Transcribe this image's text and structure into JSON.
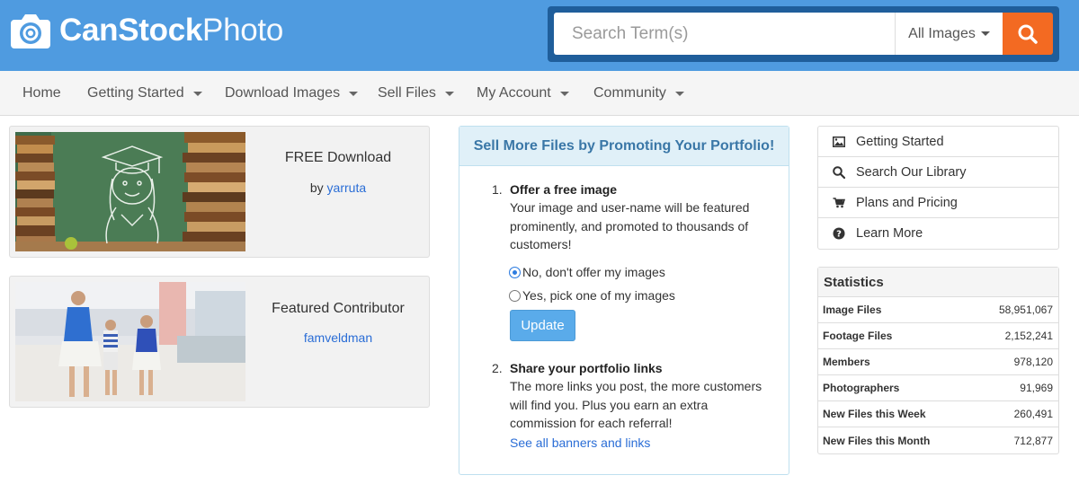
{
  "brand": {
    "name_bold": "CanStock",
    "name_light": "Photo"
  },
  "search": {
    "placeholder": "Search Term(s)",
    "scope": "All Images"
  },
  "nav": {
    "items": [
      {
        "label": "Home",
        "has_dropdown": false
      },
      {
        "label": "Getting Started",
        "has_dropdown": true
      },
      {
        "label": "Download Images",
        "has_dropdown": true
      },
      {
        "label": "Sell Files",
        "has_dropdown": true
      },
      {
        "label": "My Account",
        "has_dropdown": true
      },
      {
        "label": "Community",
        "has_dropdown": true
      }
    ]
  },
  "free_download": {
    "title": "FREE Download",
    "by_prefix": "by",
    "author": "yarruta"
  },
  "featured": {
    "title": "Featured Contributor",
    "author": "famveldman"
  },
  "promo": {
    "heading": "Sell More Files by Promoting Your Portfolio!",
    "step1": {
      "num": "1.",
      "title": "Offer a free image",
      "text": "Your image and user-name will be featured prominently, and promoted to thousands of customers!",
      "option_no": "No, don't offer my images",
      "option_yes": "Yes, pick one of my images",
      "button": "Update"
    },
    "step2": {
      "num": "2.",
      "title": "Share your portfolio links",
      "text": "The more links you post, the more customers will find you. Plus you earn an extra commission for each referral!",
      "link": "See all banners and links"
    }
  },
  "side_menu": {
    "items": [
      {
        "label": "Getting Started",
        "icon": "image-icon"
      },
      {
        "label": "Search Our Library",
        "icon": "search-icon"
      },
      {
        "label": "Plans and Pricing",
        "icon": "cart-icon"
      },
      {
        "label": "Learn More",
        "icon": "question-icon"
      }
    ]
  },
  "stats": {
    "heading": "Statistics",
    "rows": [
      {
        "label": "Image Files",
        "value": "58,951,067"
      },
      {
        "label": "Footage Files",
        "value": "2,152,241"
      },
      {
        "label": "Members",
        "value": "978,120"
      },
      {
        "label": "Photographers",
        "value": "91,969"
      },
      {
        "label": "New Files this Week",
        "value": "260,491"
      },
      {
        "label": "New Files this Month",
        "value": "712,877"
      }
    ]
  },
  "colors": {
    "header_bg": "#4f9be0",
    "search_frame": "#1f5e9b",
    "search_button": "#f36a22",
    "promo_heading": "#3a77a7",
    "link": "#2a6dd6"
  }
}
